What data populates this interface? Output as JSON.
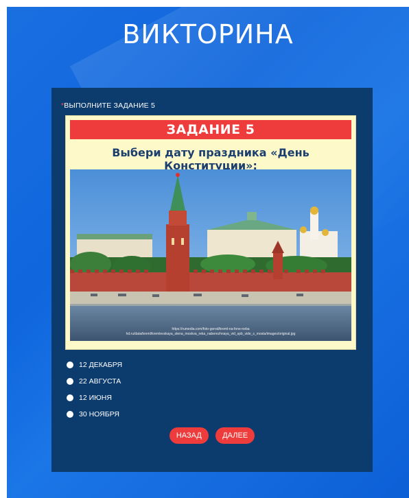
{
  "quiz": {
    "title": "ВИКТОРИНА"
  },
  "question": {
    "required_mark": "*",
    "prompt": "ВЫПОЛНИТЕ ЗАДАНИЕ 5",
    "image": {
      "banner": "ЗАДАНИЕ 5",
      "text": "Выбери дату праздника «День Конституции»:",
      "caption_line1": "https://rumedia.com/foto-gorod/kreml-na-fone-neba",
      "caption_line2": "hd.ru/data/kreml/kremlevskaya_stena_moskva_reka_naberezhnaya_vid_spb_vide_s_mosta/images/original.jpg"
    }
  },
  "options": [
    {
      "label": "12 ДЕКАБРЯ"
    },
    {
      "label": "22 АВГУСТА"
    },
    {
      "label": "12 ИЮНЯ"
    },
    {
      "label": "30 НОЯБРЯ"
    }
  ],
  "nav": {
    "back_label": "НАЗАД",
    "next_label": "ДАЛЕЕ"
  },
  "colors": {
    "background": "#1268de",
    "card": "#0c3c6e",
    "accent": "#ee3b3b",
    "image_bg": "#fef9c9",
    "question_text": "#1b3f6e"
  }
}
